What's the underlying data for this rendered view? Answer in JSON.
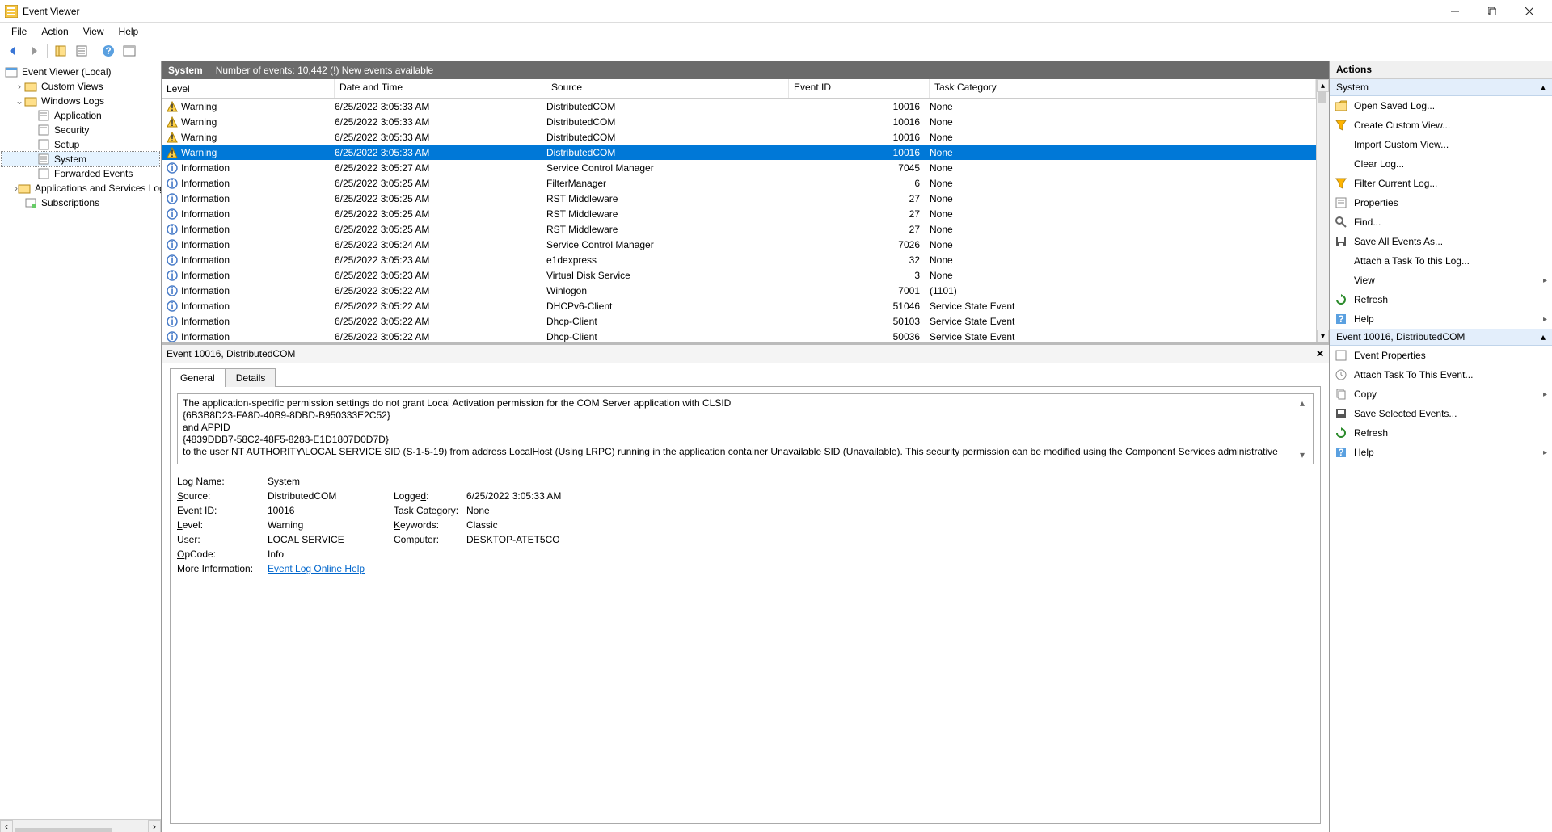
{
  "window": {
    "title": "Event Viewer"
  },
  "menu": {
    "file": "File",
    "action": "Action",
    "view": "View",
    "help": "Help"
  },
  "tree": {
    "root": "Event Viewer (Local)",
    "custom": "Custom Views",
    "winlogs": "Windows Logs",
    "application": "Application",
    "security": "Security",
    "setup": "Setup",
    "system": "System",
    "forwarded": "Forwarded Events",
    "appsvc": "Applications and Services Logs",
    "subs": "Subscriptions"
  },
  "loghdr": {
    "name": "System",
    "count": "Number of events: 10,442 (!) New events available"
  },
  "columns": {
    "level": "Level",
    "date": "Date and Time",
    "source": "Source",
    "eid": "Event ID",
    "task": "Task Category"
  },
  "levels": {
    "warning": "Warning",
    "information": "Information"
  },
  "rows": [
    {
      "lvl": "w",
      "date": "6/25/2022 3:05:33 AM",
      "src": "DistributedCOM",
      "eid": "10016",
      "task": "None"
    },
    {
      "lvl": "w",
      "date": "6/25/2022 3:05:33 AM",
      "src": "DistributedCOM",
      "eid": "10016",
      "task": "None"
    },
    {
      "lvl": "w",
      "date": "6/25/2022 3:05:33 AM",
      "src": "DistributedCOM",
      "eid": "10016",
      "task": "None"
    },
    {
      "lvl": "w",
      "date": "6/25/2022 3:05:33 AM",
      "src": "DistributedCOM",
      "eid": "10016",
      "task": "None",
      "sel": true
    },
    {
      "lvl": "i",
      "date": "6/25/2022 3:05:27 AM",
      "src": "Service Control Manager",
      "eid": "7045",
      "task": "None"
    },
    {
      "lvl": "i",
      "date": "6/25/2022 3:05:25 AM",
      "src": "FilterManager",
      "eid": "6",
      "task": "None"
    },
    {
      "lvl": "i",
      "date": "6/25/2022 3:05:25 AM",
      "src": "RST Middleware",
      "eid": "27",
      "task": "None"
    },
    {
      "lvl": "i",
      "date": "6/25/2022 3:05:25 AM",
      "src": "RST Middleware",
      "eid": "27",
      "task": "None"
    },
    {
      "lvl": "i",
      "date": "6/25/2022 3:05:25 AM",
      "src": "RST Middleware",
      "eid": "27",
      "task": "None"
    },
    {
      "lvl": "i",
      "date": "6/25/2022 3:05:24 AM",
      "src": "Service Control Manager",
      "eid": "7026",
      "task": "None"
    },
    {
      "lvl": "i",
      "date": "6/25/2022 3:05:23 AM",
      "src": "e1dexpress",
      "eid": "32",
      "task": "None"
    },
    {
      "lvl": "i",
      "date": "6/25/2022 3:05:23 AM",
      "src": "Virtual Disk Service",
      "eid": "3",
      "task": "None"
    },
    {
      "lvl": "i",
      "date": "6/25/2022 3:05:22 AM",
      "src": "Winlogon",
      "eid": "7001",
      "task": "(1101)"
    },
    {
      "lvl": "i",
      "date": "6/25/2022 3:05:22 AM",
      "src": "DHCPv6-Client",
      "eid": "51046",
      "task": "Service State Event"
    },
    {
      "lvl": "i",
      "date": "6/25/2022 3:05:22 AM",
      "src": "Dhcp-Client",
      "eid": "50103",
      "task": "Service State Event"
    },
    {
      "lvl": "i",
      "date": "6/25/2022 3:05:22 AM",
      "src": "Dhcp-Client",
      "eid": "50036",
      "task": "Service State Event"
    }
  ],
  "detail": {
    "title": "Event 10016, DistributedCOM",
    "tabs": {
      "general": "General",
      "details": "Details"
    },
    "desc1": "The application-specific permission settings do not grant Local Activation permission for the COM Server application with CLSID",
    "desc2": "{6B3B8D23-FA8D-40B9-8DBD-B950333E2C52}",
    "desc3": "and APPID",
    "desc4": "{4839DDB7-58C2-48F5-8283-E1D1807D0D7D}",
    "desc5": " to the user NT AUTHORITY\\LOCAL SERVICE SID (S-1-5-19) from address LocalHost (Using LRPC) running in the application container Unavailable SID (Unavailable). This security permission can be modified using the Component Services administrative tool.",
    "labels": {
      "logname": "Log Name:",
      "source": "Source:",
      "eventid": "Event ID:",
      "level": "Level:",
      "user": "User:",
      "opcode": "OpCode:",
      "moreinfo": "More Information:",
      "logged": "Logged:",
      "taskcat": "Task Category:",
      "keywords": "Keywords:",
      "computer": "Computer:"
    },
    "values": {
      "logname": "System",
      "source": "DistributedCOM",
      "eventid": "10016",
      "level": "Warning",
      "user": "LOCAL SERVICE",
      "opcode": "Info",
      "helplink": "Event Log Online Help",
      "logged": "6/25/2022 3:05:33 AM",
      "taskcat": "None",
      "keywords": "Classic",
      "computer": "DESKTOP-ATET5CO"
    }
  },
  "actions": {
    "title": "Actions",
    "sect1": "System",
    "open": "Open Saved Log...",
    "createview": "Create Custom View...",
    "importview": "Import Custom View...",
    "clearlog": "Clear Log...",
    "filter": "Filter Current Log...",
    "properties": "Properties",
    "find": "Find...",
    "saveall": "Save All Events As...",
    "attach": "Attach a Task To this Log...",
    "view": "View",
    "refresh": "Refresh",
    "help": "Help",
    "sect2": "Event 10016, DistributedCOM",
    "evprops": "Event Properties",
    "evattach": "Attach Task To This Event...",
    "copy": "Copy",
    "savesel": "Save Selected Events...",
    "refresh2": "Refresh",
    "help2": "Help"
  }
}
